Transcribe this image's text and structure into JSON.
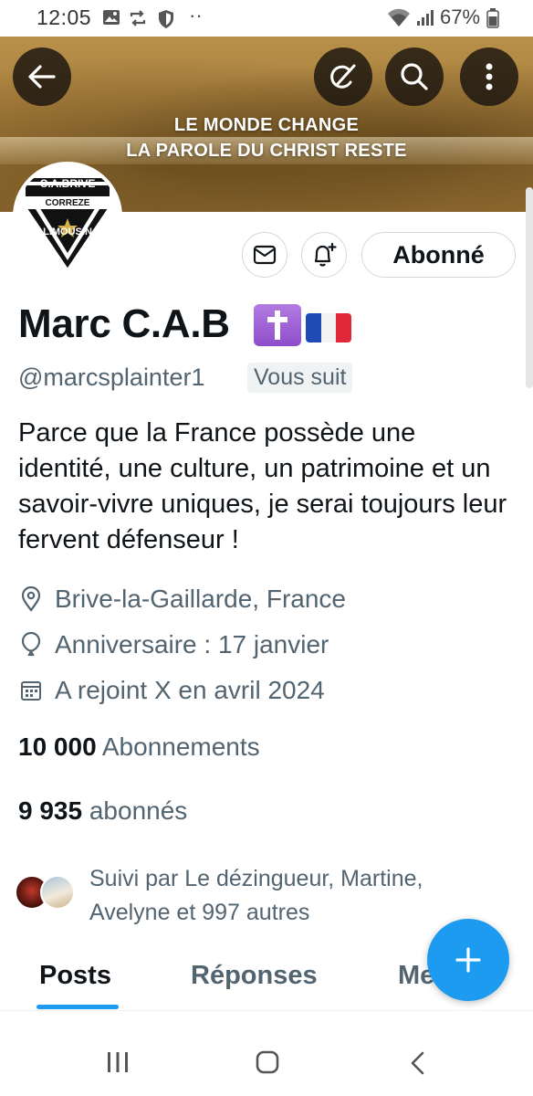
{
  "status_bar": {
    "time": "12:05",
    "dots": "··",
    "battery": "67%"
  },
  "banner": {
    "line1": "LE MONDE CHANGE",
    "line2": "LA PAROLE DU CHRIST RESTE"
  },
  "avatar": {
    "top_text": "C.A.BRIVE",
    "middle_text": "CORREZE",
    "bottom_text": "LIMOUSIN"
  },
  "profile": {
    "name": "Marc C.A.B",
    "handle": "@marcsplainter1",
    "follows_you": "Vous suit",
    "follow_button": "Abonné",
    "bio": "Parce que la France possède une identité, une culture, un patrimoine et un savoir-vivre uniques, je serai toujours leur fervent défenseur !",
    "location": "Brive-la-Gaillarde, France",
    "birthday": "Anniversaire : 17 janvier",
    "joined": "A rejoint X en avril 2024",
    "following_count": "10 000",
    "following_label": "Abonnements",
    "followers_count": "9 935",
    "followers_label": "abonnés",
    "followed_by_line1": "Suivi par Le dézingueur, Martine,",
    "followed_by_line2": "Avelyne et 997 autres"
  },
  "tabs": [
    {
      "label": "Posts"
    },
    {
      "label": "Réponses"
    },
    {
      "label": "Me"
    }
  ],
  "colors": {
    "accent": "#1d9bf0",
    "secondary_text": "#536471",
    "primary_text": "#0f1419"
  }
}
